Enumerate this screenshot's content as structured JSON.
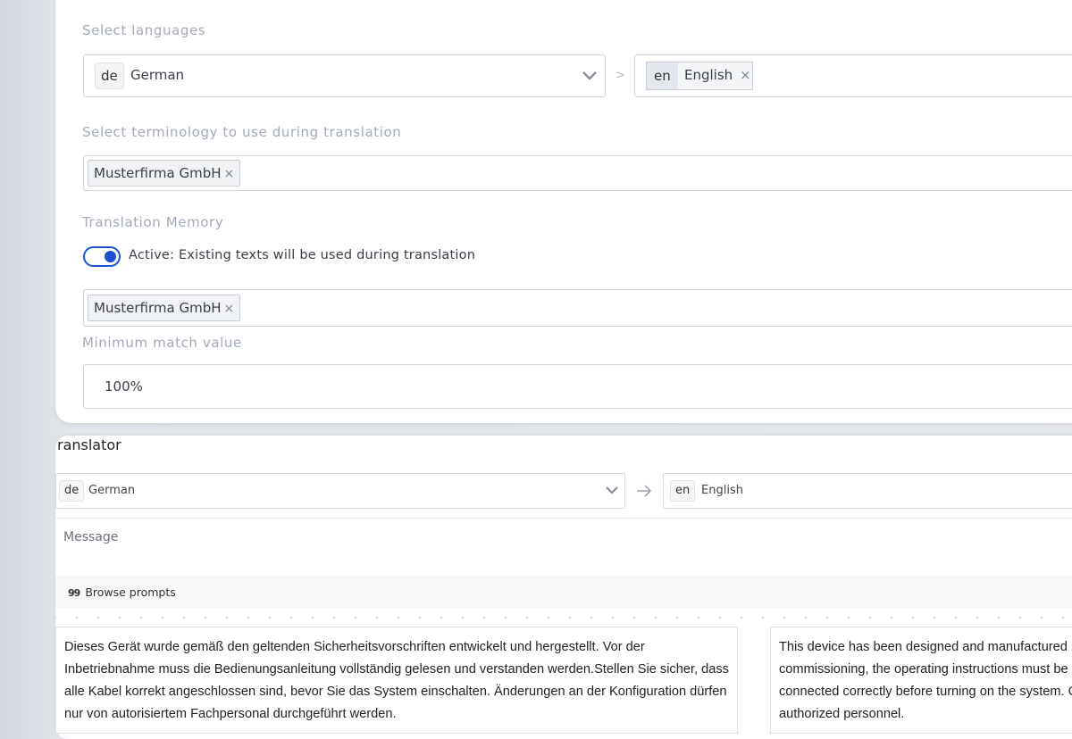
{
  "settings": {
    "languages_label": "Select languages",
    "source_language": {
      "code": "de",
      "name": "German"
    },
    "separator": ">",
    "target_language": {
      "code": "en",
      "name": "English"
    },
    "terminology_label": "Select terminology to use during translation",
    "terminology_chip": "Musterfirma GmbH",
    "memory_label": "Translation Memory",
    "memory_toggle_text": "Active: Existing texts will be used during translation",
    "memory_chip": "Musterfirma GmbH",
    "min_match_label": "Minimum match value",
    "min_match_value": "100%",
    "remove_glyph": "×",
    "chevron_glyph": "⌄"
  },
  "translator": {
    "title": "ranslator",
    "source_language": {
      "code": "de",
      "name": "German"
    },
    "arrow": "→",
    "target_language": {
      "code": "en",
      "name": "English"
    },
    "message_placeholder": "Message",
    "browse_icon": "99",
    "browse_label": "Browse prompts",
    "source_text": "Dieses Gerät wurde gemäß den geltenden Sicherheitsvorschriften entwickelt und hergestellt. Vor der Inbetriebnahme muss die Bedienungsanleitung vollständig gelesen und verstanden werden.Stellen Sie sicher, dass alle Kabel korrekt angeschlossen sind, bevor Sie das System einschalten. Änderungen an der Konfiguration dürfen nur von autorisiertem Fachpersonal durchgeführt werden.",
    "target_text": "This device has been designed and manufactured in accordance with applicable safety regulations. Before commissioning, the operating instructions must be read and fully understood. Make sure all cables are connected correctly before turning on the system. Changes to the configuration may only be made by authorized personnel."
  },
  "colors": {
    "accent": "#1a52cf",
    "label": "#a3aab8",
    "border": "#cfd4db"
  }
}
